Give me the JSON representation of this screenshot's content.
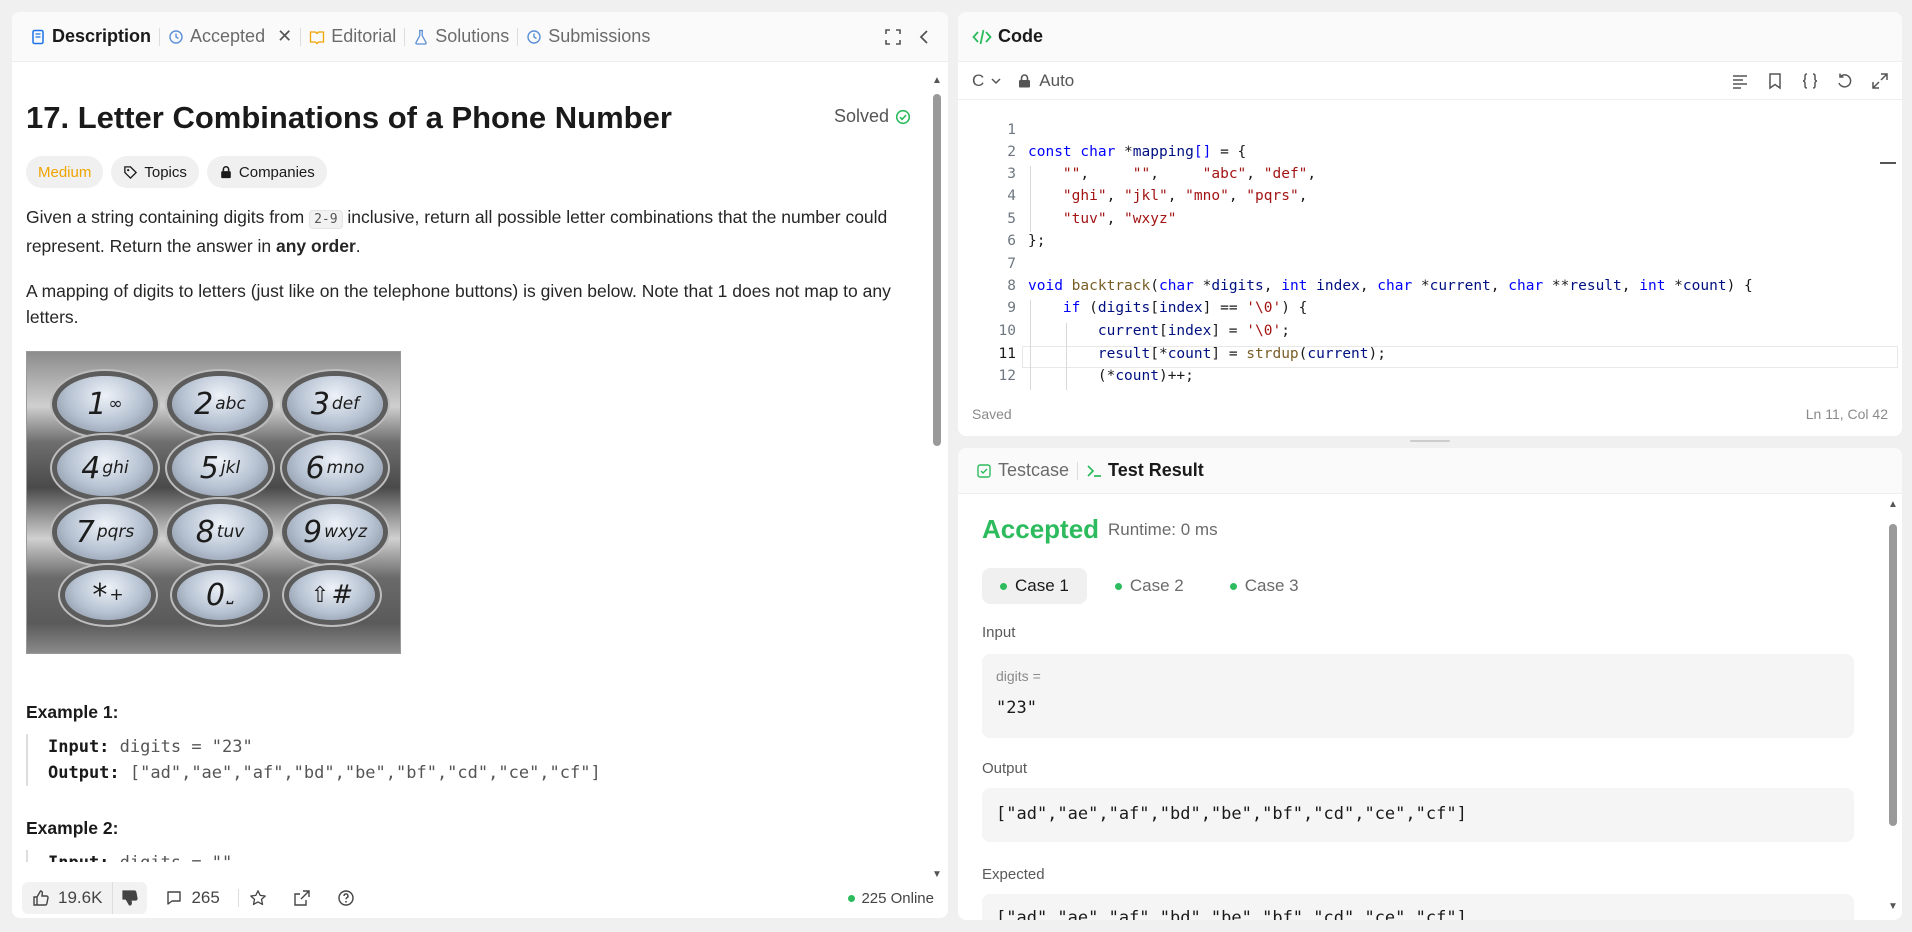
{
  "tabs": {
    "description": "Description",
    "accepted": "Accepted",
    "editorial": "Editorial",
    "solutions": "Solutions",
    "submissions": "Submissions"
  },
  "problem": {
    "title": "17. Letter Combinations of a Phone Number",
    "status": "Solved",
    "difficulty": "Medium",
    "topics_label": "Topics",
    "companies_label": "Companies",
    "desc_part1": "Given a string containing digits from ",
    "desc_code": "2-9",
    "desc_part2": " inclusive, return all possible letter combinations that the number could represent. Return the answer in ",
    "desc_bold": "any order",
    "desc_end": ".",
    "mapping_text": "A mapping of digits to letters (just like on the telephone buttons) is given below. Note that 1 does not map to any letters.",
    "keypad": [
      {
        "digit": "1",
        "letters": "∞"
      },
      {
        "digit": "2",
        "letters": "abc"
      },
      {
        "digit": "3",
        "letters": "def"
      },
      {
        "digit": "4",
        "letters": "ghi"
      },
      {
        "digit": "5",
        "letters": "jkl"
      },
      {
        "digit": "6",
        "letters": "mno"
      },
      {
        "digit": "7",
        "letters": "pqrs"
      },
      {
        "digit": "8",
        "letters": "tuv"
      },
      {
        "digit": "9",
        "letters": "wxyz"
      },
      {
        "digit": "*",
        "letters": "+"
      },
      {
        "digit": "0",
        "letters": "⎵"
      },
      {
        "digit": "⇧",
        "letters": "#"
      }
    ],
    "example1_title": "Example 1:",
    "example1_input_label": "Input:",
    "example1_input": "digits = \"23\"",
    "example1_output_label": "Output:",
    "example1_output": "[\"ad\",\"ae\",\"af\",\"bd\",\"be\",\"bf\",\"cd\",\"ce\",\"cf\"]",
    "example2_title": "Example 2:",
    "example2_input_label": "Input:",
    "example2_input": "digits = \"\""
  },
  "footer": {
    "likes": "19.6K",
    "comments": "265",
    "online": "225 Online"
  },
  "code": {
    "tab_label": "Code",
    "language": "C",
    "mode": "Auto",
    "saved": "Saved",
    "position": "Ln 11, Col 42",
    "line_numbers": [
      "1",
      "2",
      "3",
      "4",
      "5",
      "6",
      "7",
      "8",
      "9",
      "10",
      "11",
      "12"
    ]
  },
  "result": {
    "tab_testcase": "Testcase",
    "tab_result": "Test Result",
    "status": "Accepted",
    "runtime": "Runtime: 0 ms",
    "cases": [
      "Case 1",
      "Case 2",
      "Case 3"
    ],
    "input_label": "Input",
    "input_var": "digits =",
    "input_value": "\"23\"",
    "output_label": "Output",
    "output_value": "[\"ad\",\"ae\",\"af\",\"bd\",\"be\",\"bf\",\"cd\",\"ce\",\"cf\"]",
    "expected_label": "Expected",
    "expected_value": "[\"ad\",\"ae\",\"af\",\"bd\",\"be\",\"bf\",\"cd\",\"ce\",\"cf\"]"
  },
  "colors": {
    "accent_green": "#2cbb5d",
    "medium_orange": "#f0a400"
  }
}
